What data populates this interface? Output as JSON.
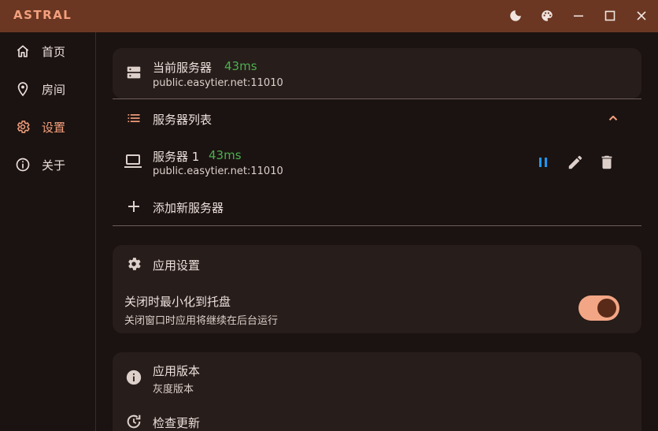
{
  "app": {
    "title": "ASTRAL"
  },
  "titlebar": {
    "buttons": [
      "theme-mode-icon",
      "palette-icon",
      "minimize-icon",
      "maximize-icon",
      "close-icon"
    ]
  },
  "sidebar": {
    "items": [
      {
        "label": "首页",
        "icon": "home-icon"
      },
      {
        "label": "房间",
        "icon": "location-pin-icon"
      },
      {
        "label": "设置",
        "icon": "gear-icon",
        "active": true
      },
      {
        "label": "关于",
        "icon": "info-icon"
      }
    ]
  },
  "current_server": {
    "title": "当前服务器",
    "latency": "43ms",
    "address": "public.easytier.net:11010"
  },
  "server_list": {
    "title": "服务器列表",
    "expanded": true,
    "servers": [
      {
        "name": "服务器 1",
        "latency": "43ms",
        "address": "public.easytier.net:11010"
      }
    ],
    "add_label": "添加新服务器"
  },
  "app_settings": {
    "title": "应用设置",
    "minimize_to_tray": {
      "label": "关闭时最小化到托盘",
      "description": "关闭窗口时应用将继续在后台运行",
      "enabled": true
    }
  },
  "version": {
    "title": "应用版本",
    "value": "灰度版本",
    "check_update_label": "检查更新"
  },
  "colors": {
    "accent": "#f5a07d",
    "titlebar": "#6b3722",
    "background": "#1b1311",
    "card": "#271d1a",
    "latency_green": "#4caf50",
    "pause_blue": "#2196f3"
  }
}
